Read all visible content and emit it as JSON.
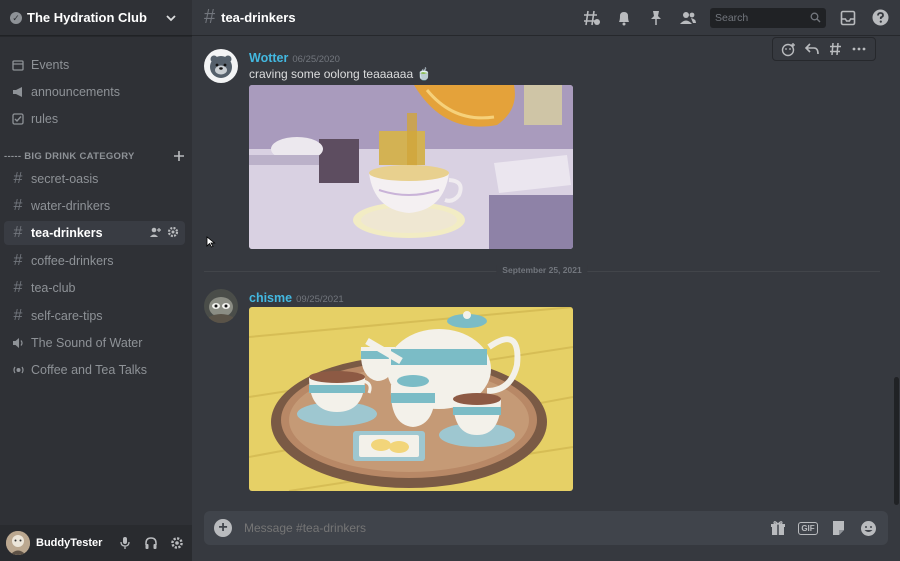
{
  "server": {
    "name": "The Hydration Club"
  },
  "channels": [
    {
      "label": "Events",
      "icon": "calendar-icon"
    },
    {
      "label": "announcements",
      "icon": "megaphone-icon"
    },
    {
      "label": "rules",
      "icon": "checkbox-icon"
    }
  ],
  "category": {
    "label": "----- BIG DRINK CATEGORY"
  },
  "category_channels": [
    {
      "label": "secret-oasis",
      "icon": "hash-icon"
    },
    {
      "label": "water-drinkers",
      "icon": "hash-icon"
    },
    {
      "label": "tea-drinkers",
      "icon": "hash-icon",
      "active": true
    },
    {
      "label": "coffee-drinkers",
      "icon": "hash-icon"
    },
    {
      "label": "tea-club",
      "icon": "hash-icon"
    },
    {
      "label": "self-care-tips",
      "icon": "hash-icon"
    },
    {
      "label": "The Sound of Water",
      "icon": "voice-icon"
    },
    {
      "label": "Coffee and Tea Talks",
      "icon": "stage-icon"
    }
  ],
  "user": {
    "name": "BuddyTester"
  },
  "topbar": {
    "channel": "tea-drinkers",
    "search_placeholder": "Search"
  },
  "messages": [
    {
      "author": "Wotter",
      "timestamp": "06/25/2020",
      "text": "craving some oolong teaaaaaa 🍵"
    },
    {
      "author": "chisme",
      "timestamp": "09/25/2021",
      "text": ""
    }
  ],
  "divider": {
    "date": "September 25, 2021"
  },
  "composer": {
    "placeholder": "Message #tea-drinkers",
    "gif_label": "GIF"
  },
  "colors": {
    "author": "#43b8e0",
    "background": "#36393f",
    "sidebar": "#2f3136"
  }
}
